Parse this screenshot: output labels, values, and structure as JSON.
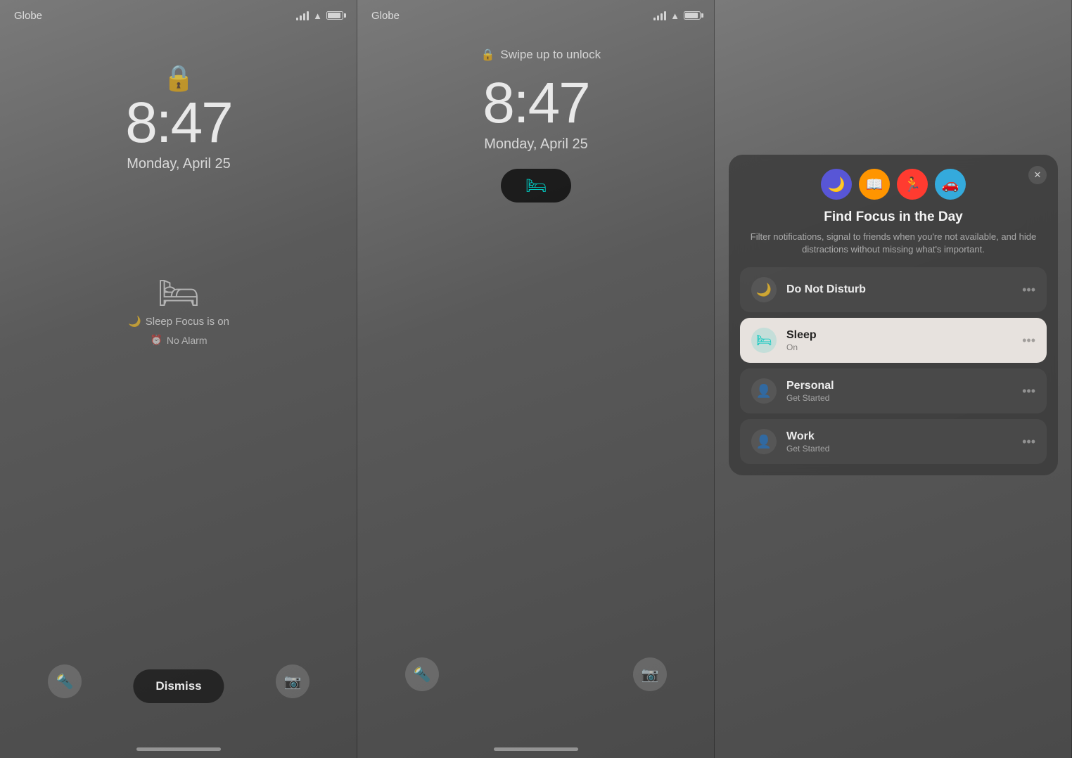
{
  "panel1": {
    "carrier": "Globe",
    "time": "8:47",
    "date": "Monday, April 25",
    "sleep_label": "Sleep Focus is on",
    "alarm_label": "No Alarm",
    "dismiss_label": "Dismiss"
  },
  "panel2": {
    "carrier": "Globe",
    "swipe_label": "Swipe up to unlock",
    "time": "8:47",
    "date": "Monday, April 25"
  },
  "panel3": {
    "focus_title": "Find Focus in the Day",
    "focus_desc": "Filter notifications, signal to friends when you're not available, and hide distractions without missing what's important.",
    "modes": [
      {
        "icon": "🌙",
        "class": "sleep-mode"
      },
      {
        "icon": "📖",
        "class": "book-mode"
      },
      {
        "icon": "🏃",
        "class": "fitness-mode"
      },
      {
        "icon": "🚗",
        "class": "drive-mode"
      }
    ],
    "items": [
      {
        "name": "Do Not Disturb",
        "sub": "",
        "icon": "🌙",
        "active": false
      },
      {
        "name": "Sleep",
        "sub": "On",
        "icon": "🛏",
        "active": true
      },
      {
        "name": "Personal",
        "sub": "Get Started",
        "icon": "👤",
        "active": false
      },
      {
        "name": "Work",
        "sub": "Get Started",
        "icon": "👤",
        "active": false
      }
    ]
  }
}
